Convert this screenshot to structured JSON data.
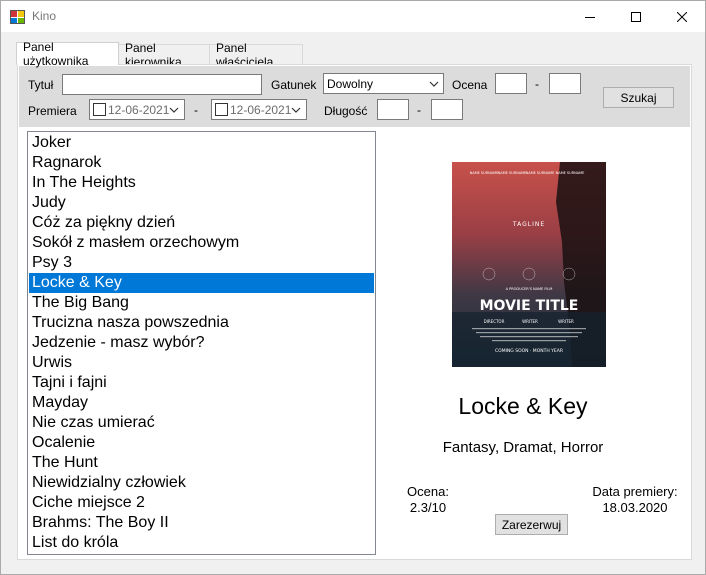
{
  "window": {
    "title": "Kino",
    "controls": {
      "minimize": "—",
      "maximize": "☐",
      "close": "✕"
    }
  },
  "tabs": [
    {
      "label": "Panel użytkownika",
      "active": true
    },
    {
      "label": "Panel kierownika",
      "active": false
    },
    {
      "label": "Panel właściciela",
      "active": false
    }
  ],
  "filters": {
    "title_label": "Tytuł",
    "title_value": "",
    "genre_label": "Gatunek",
    "genre_value": "Dowolny",
    "rating_label": "Ocena",
    "rating_from": "",
    "rating_sep": "-",
    "rating_to": "",
    "premiere_label": "Premiera",
    "premiere_from": "12-06-2021",
    "premiere_sep": "-",
    "premiere_to": "12-06-2021",
    "length_label": "Długość",
    "length_from": "",
    "length_sep": "-",
    "length_to": "",
    "search_button": "Szukaj"
  },
  "movies": [
    "Joker",
    "Ragnarok",
    "In The Heights",
    "Judy",
    "Cóż za piękny dzień",
    "Sokół z masłem orzechowym",
    "Psy 3",
    "Locke & Key",
    "The Big Bang",
    "Trucizna nasza powszednia",
    "Jedzenie - masz wybór?",
    "Urwis",
    "Tajni i fajni",
    "Mayday",
    "Nie czas umierać",
    "Ocalenie",
    "The Hunt",
    "Niewidzialny człowiek",
    "Ciche miejsce 2",
    "Brahms: The Boy II",
    "List do króla"
  ],
  "selected_index": 7,
  "detail": {
    "title": "Locke & Key",
    "genres": "Fantasy, Dramat, Horror",
    "rating_label": "Ocena:",
    "rating_value": "2.3/10",
    "premiere_label": "Data premiery:",
    "premiere_value": "18.03.2020",
    "reserve_button": "Zarezerwuj",
    "poster": {
      "names": [
        "NAME SURNAME",
        "NAME SURNAME",
        "NAME SURNAME",
        "NAME SURNAME"
      ],
      "tagline": "TAGLINE",
      "producer_line": "A PRODUCER'S NAME FILM",
      "movie_title": "MOVIE TITLE",
      "credits_roles": [
        "DIRECTOR",
        "WRITER",
        "WRITER"
      ],
      "coming_soon": "COMING SOON · MONTH YEAR"
    }
  },
  "colors": {
    "selection": "#0078d7",
    "panel_gray": "#dcdcdc",
    "window_bg": "#f0f0f0"
  }
}
